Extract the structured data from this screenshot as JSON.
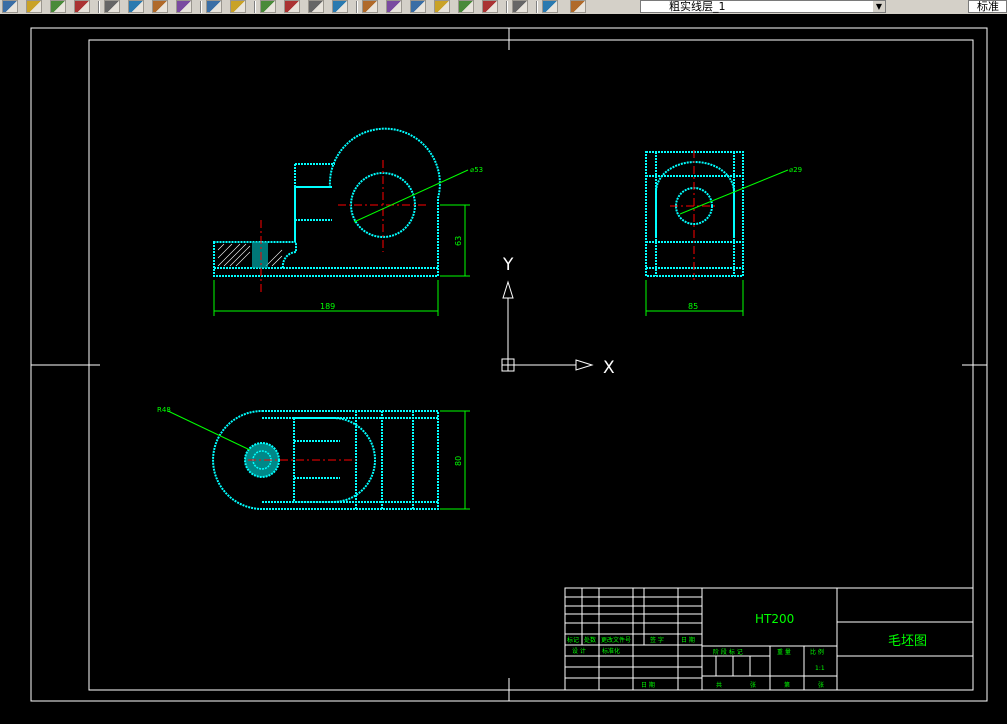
{
  "toolbar": {
    "icons": [
      "new-icon",
      "open-icon",
      "save-icon",
      "print-icon",
      "cut-icon",
      "copy-icon",
      "paste-icon",
      "match-properties-icon",
      "undo-icon",
      "redo-icon",
      "pan-icon",
      "zoom-realtime-icon",
      "zoom-window-icon",
      "zoom-previous-icon",
      "properties-icon",
      "design-center-icon",
      "tool-palettes-icon",
      "sheet-set-icon",
      "markup-icon",
      "calculator-icon",
      "help-icon",
      "layer-manager-icon",
      "layer-state-icon"
    ],
    "layer_name": "粗实线层_1",
    "style_name": "标准",
    "colors": {
      "bg": "#d4d0c8"
    }
  },
  "drawing": {
    "colors": {
      "background": "#000000",
      "frame": "#ffffff",
      "outline": "#00ffff",
      "dimension": "#00ff00",
      "center": "#ff0000"
    },
    "dimensions": {
      "front_diameter": "⌀53",
      "front_height": "63",
      "front_length": "189",
      "side_diameter": "⌀29",
      "side_width": "85",
      "top_radius": "R48",
      "top_width": "80"
    },
    "ucs": {
      "y_label": "Y",
      "x_label": "X"
    },
    "title_block": {
      "material": "HT200",
      "drawing_name": "毛坯图",
      "labels": {
        "mark": "标记",
        "count": "处数",
        "doc_no": "更改文件号",
        "signature": "签 字",
        "date": "日 期",
        "design": "设 计",
        "standardize": "标准化",
        "stage_mark": "阶 段 标 记",
        "weight": "重 量",
        "scale": "比 例",
        "scale_value": "1:1",
        "total": "共",
        "sheet": "张",
        "page": "第",
        "sheet2": "张",
        "review_date": "日 期"
      }
    }
  }
}
